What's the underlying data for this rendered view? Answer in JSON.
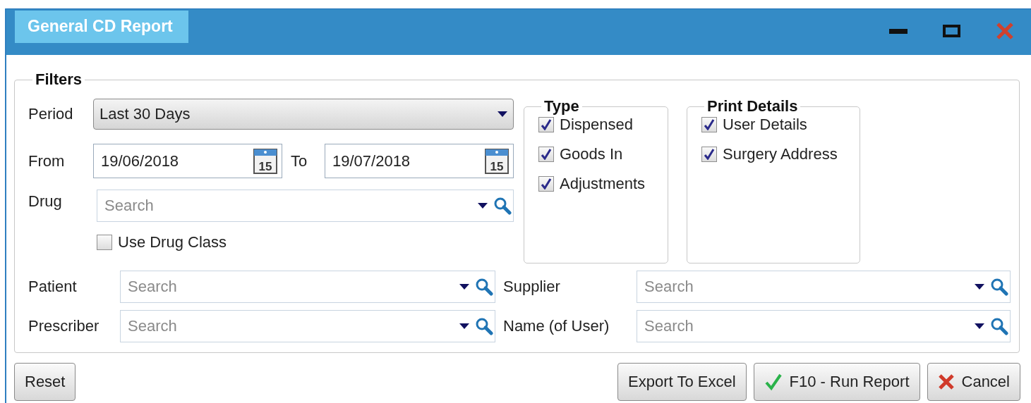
{
  "window": {
    "title": "General CD Report"
  },
  "filters": {
    "title": "Filters",
    "period": {
      "label": "Period",
      "value": "Last 30 Days"
    },
    "from": {
      "label": "From",
      "value": "19/06/2018",
      "calendar_day": "15"
    },
    "to": {
      "label": "To",
      "value": "19/07/2018",
      "calendar_day": "15"
    },
    "drug": {
      "label": "Drug",
      "placeholder": "Search"
    },
    "use_drug_class": {
      "label": "Use Drug Class",
      "checked": false
    },
    "type": {
      "title": "Type",
      "options": [
        {
          "label": "Dispensed",
          "checked": true
        },
        {
          "label": "Goods In",
          "checked": true
        },
        {
          "label": "Adjustments",
          "checked": true
        }
      ]
    },
    "print_details": {
      "title": "Print Details",
      "options": [
        {
          "label": "User Details",
          "checked": true
        },
        {
          "label": "Surgery Address",
          "checked": true
        }
      ]
    },
    "lookups": [
      {
        "label": "Patient",
        "placeholder": "Search"
      },
      {
        "label": "Supplier",
        "placeholder": "Search"
      },
      {
        "label": "Prescriber",
        "placeholder": "Search"
      },
      {
        "label": "Name (of User)",
        "placeholder": "Search"
      }
    ]
  },
  "buttons": [
    {
      "label": "Reset",
      "kind": "reset"
    },
    {
      "label": "Export To Excel",
      "kind": "export"
    },
    {
      "label": "F10 - Run Report",
      "kind": "run"
    },
    {
      "label": "Cancel",
      "kind": "cancel"
    }
  ]
}
